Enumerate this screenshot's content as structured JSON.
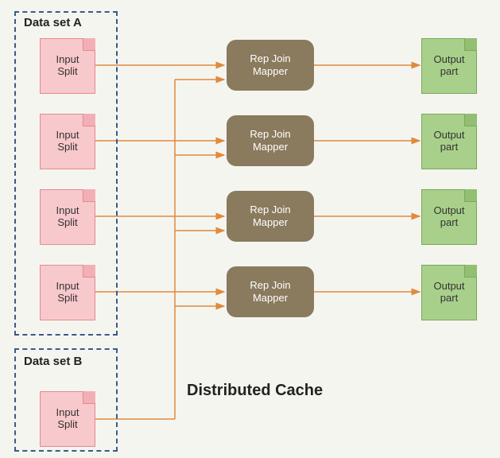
{
  "datasetA": {
    "label": "Data set A",
    "items": [
      {
        "label": "Input\nSplit"
      },
      {
        "label": "Input\nSplit"
      },
      {
        "label": "Input\nSplit"
      },
      {
        "label": "Input\nSplit"
      }
    ]
  },
  "datasetB": {
    "label": "Data set B",
    "item": {
      "label": "Input\nSplit"
    }
  },
  "mappers": [
    {
      "label": "Rep Join\nMapper"
    },
    {
      "label": "Rep Join\nMapper"
    },
    {
      "label": "Rep Join\nMapper"
    },
    {
      "label": "Rep Join\nMapper"
    }
  ],
  "outputs": [
    {
      "label": "Output\npart"
    },
    {
      "label": "Output\npart"
    },
    {
      "label": "Output\npart"
    },
    {
      "label": "Output\npart"
    }
  ],
  "title": "Distributed Cache",
  "colors": {
    "arrow": "#e08a3c",
    "dash": "#3a5a8a",
    "pink": "#f7c8cc",
    "green": "#a8d08a",
    "mapper": "#8a7a5e"
  }
}
